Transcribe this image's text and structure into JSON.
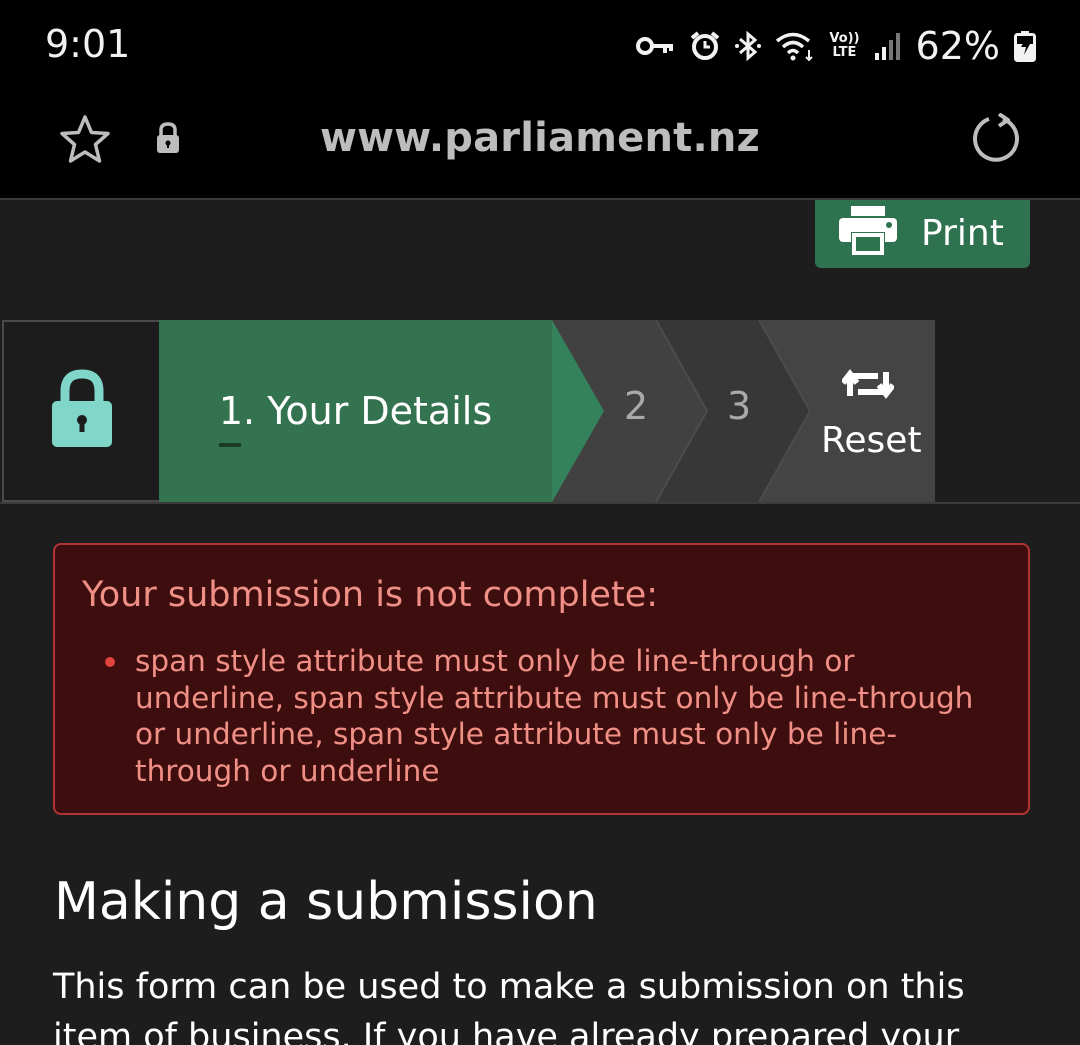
{
  "status_bar": {
    "time": "9:01",
    "icons": [
      "key-icon",
      "alarm-icon",
      "bluetooth-icon",
      "wifi-icon",
      "volte-icon",
      "signal-icon",
      "battery-icon"
    ],
    "volte_top": "Vo))",
    "volte_bottom": "LTE",
    "battery": "62%"
  },
  "browser": {
    "url": "www.parliament.nz",
    "icons": [
      "star-icon",
      "lock-icon",
      "reload-icon"
    ]
  },
  "toolbar": {
    "print_label": "Print"
  },
  "steps": {
    "lock_icon": "padlock-icon",
    "step1_label": "1. Your Details",
    "step2_label": "2",
    "step3_label": "3",
    "reset_label": "Reset",
    "colors": {
      "active": "#33734f",
      "lock": "#7fd6c9"
    }
  },
  "error": {
    "title": "Your submission is not complete:",
    "items": [
      "span style attribute must only be line-through or underline, span style attribute must only be line-through or underline, span style attribute must only be line-through or underline"
    ],
    "colors": {
      "background": "#3e0e0e",
      "border": "#b03434",
      "text": "#f08f86"
    }
  },
  "content": {
    "heading": "Making a submission",
    "paragraph": "This form can be used to make a submission on this item of business. If you have already prepared your"
  }
}
